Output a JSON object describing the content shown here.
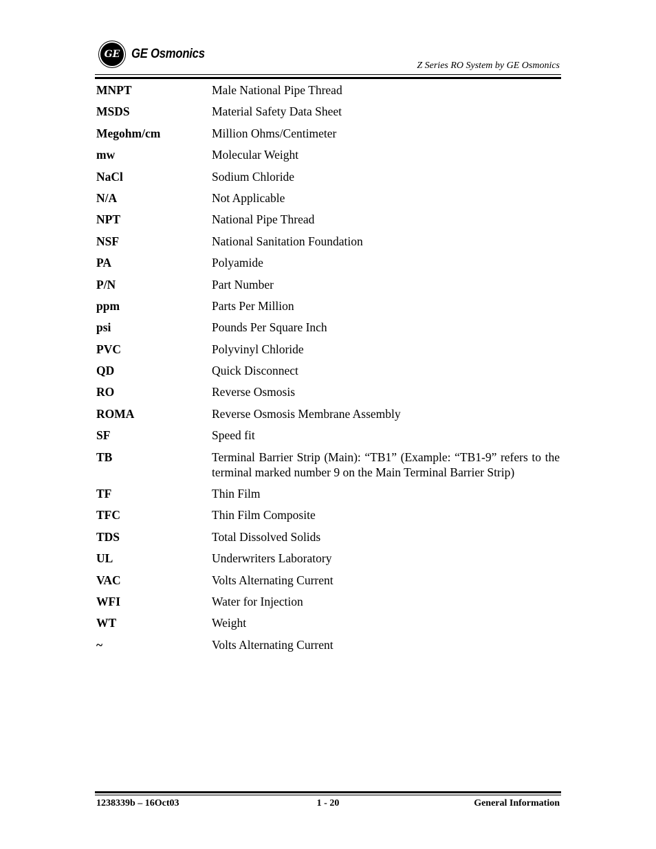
{
  "header": {
    "brand": "GE Osmonics",
    "logo_mark": "GE",
    "doc_title": "Z Series RO System by GE Osmonics"
  },
  "glossary": [
    {
      "term": "MNPT",
      "definition": "Male National Pipe Thread"
    },
    {
      "term": "MSDS",
      "definition": "Material Safety Data Sheet"
    },
    {
      "term": "Megohm/cm",
      "definition": "Million Ohms/Centimeter"
    },
    {
      "term": "mw",
      "definition": "Molecular Weight"
    },
    {
      "term": "NaCl",
      "definition": "Sodium Chloride"
    },
    {
      "term": "N/A",
      "definition": "Not Applicable"
    },
    {
      "term": "NPT",
      "definition": "National Pipe Thread"
    },
    {
      "term": "NSF",
      "definition": "National Sanitation Foundation"
    },
    {
      "term": "PA",
      "definition": "Polyamide"
    },
    {
      "term": "P/N",
      "definition": "Part Number"
    },
    {
      "term": "ppm",
      "definition": "Parts Per Million"
    },
    {
      "term": "psi",
      "definition": "Pounds Per Square Inch"
    },
    {
      "term": "PVC",
      "definition": "Polyvinyl Chloride"
    },
    {
      "term": "QD",
      "definition": "Quick Disconnect"
    },
    {
      "term": "RO",
      "definition": "Reverse Osmosis"
    },
    {
      "term": "ROMA",
      "definition": "Reverse Osmosis Membrane Assembly"
    },
    {
      "term": "SF",
      "definition": "Speed fit"
    },
    {
      "term": "TB",
      "definition": "Terminal Barrier Strip (Main): “TB1” (Example:  “TB1-9”  refers to the terminal marked number 9 on the Main Terminal Barrier Strip)"
    },
    {
      "term": "TF",
      "definition": "Thin Film"
    },
    {
      "term": "TFC",
      "definition": "Thin Film Composite"
    },
    {
      "term": "TDS",
      "definition": "Total Dissolved Solids"
    },
    {
      "term": "UL",
      "definition": "Underwriters Laboratory"
    },
    {
      "term": "VAC",
      "definition": "Volts Alternating Current"
    },
    {
      "term": "WFI",
      "definition": "Water for Injection"
    },
    {
      "term": "WT",
      "definition": "Weight"
    },
    {
      "term": "~",
      "definition": "Volts Alternating Current"
    }
  ],
  "footer": {
    "doc_number": "1238339b – 16Oct03",
    "page_number": "1 - 20",
    "section": "General Information"
  }
}
